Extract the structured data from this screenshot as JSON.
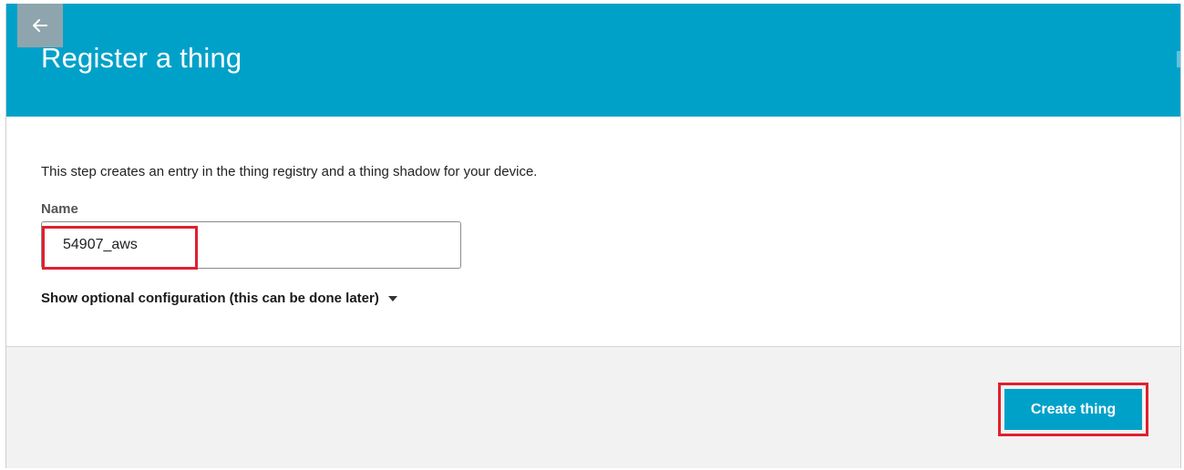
{
  "header": {
    "title": "Register a thing",
    "back_icon": "arrow-left-icon"
  },
  "form": {
    "description": "This step creates an entry in the thing registry and a thing shadow for your device.",
    "name_label": "Name",
    "name_value": "54907_aws",
    "optional_config_label": "Show optional configuration (this can be done later)",
    "optional_config_icon": "caret-down-icon"
  },
  "footer": {
    "create_label": "Create thing"
  },
  "colors": {
    "header_bg": "#00a1c9",
    "primary_button": "#00a1c9",
    "highlight": "#e0202e",
    "footer_bg": "#f2f2f2"
  }
}
